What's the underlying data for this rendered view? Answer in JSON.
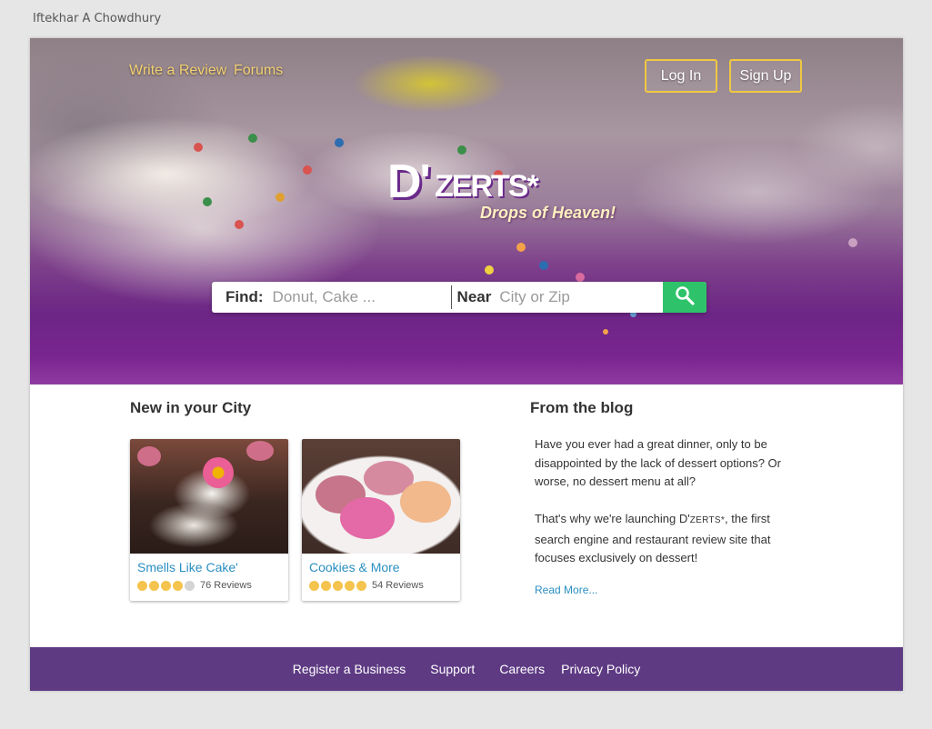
{
  "author": "Iftekhar A Chowdhury",
  "nav": {
    "write_review": "Write a Review",
    "forums": "Forums",
    "login": "Log In",
    "signup": "Sign Up"
  },
  "brand": {
    "logo_d": "D'",
    "logo_rest": "ZERTS*",
    "tagline": "Drops of Heaven!"
  },
  "search": {
    "find_label": "Find:",
    "find_placeholder": "Donut, Cake ...",
    "near_label": "Near",
    "near_placeholder": "City or Zip",
    "button_icon": "search-icon"
  },
  "new_in_city": {
    "title": "New in your City",
    "cards": [
      {
        "name": "Smells Like Cake'",
        "rating": 4,
        "reviews": "76 Reviews"
      },
      {
        "name": "Cookies & More",
        "rating": 5,
        "reviews": "54 Reviews"
      }
    ]
  },
  "blog": {
    "title": "From the blog",
    "para1": "Have you ever had a great dinner, only to be disappointed by the lack of dessert options? Or worse, no dessert menu at all?",
    "para2_before": "That's why we're launching D'",
    "para2_brand": "zerts*",
    "para2_after": ", the first search engine and restaurant review site that focuses exclusively on dessert!",
    "read_more": "Read More..."
  },
  "footer": {
    "links": [
      "Register a Business",
      "Support",
      "Careers",
      "Privacy Policy"
    ]
  },
  "colors": {
    "accent_green": "#2ec36a",
    "footer_purple": "#5e3a83",
    "link_blue": "#2a8fc1",
    "gold": "#f0c842"
  }
}
